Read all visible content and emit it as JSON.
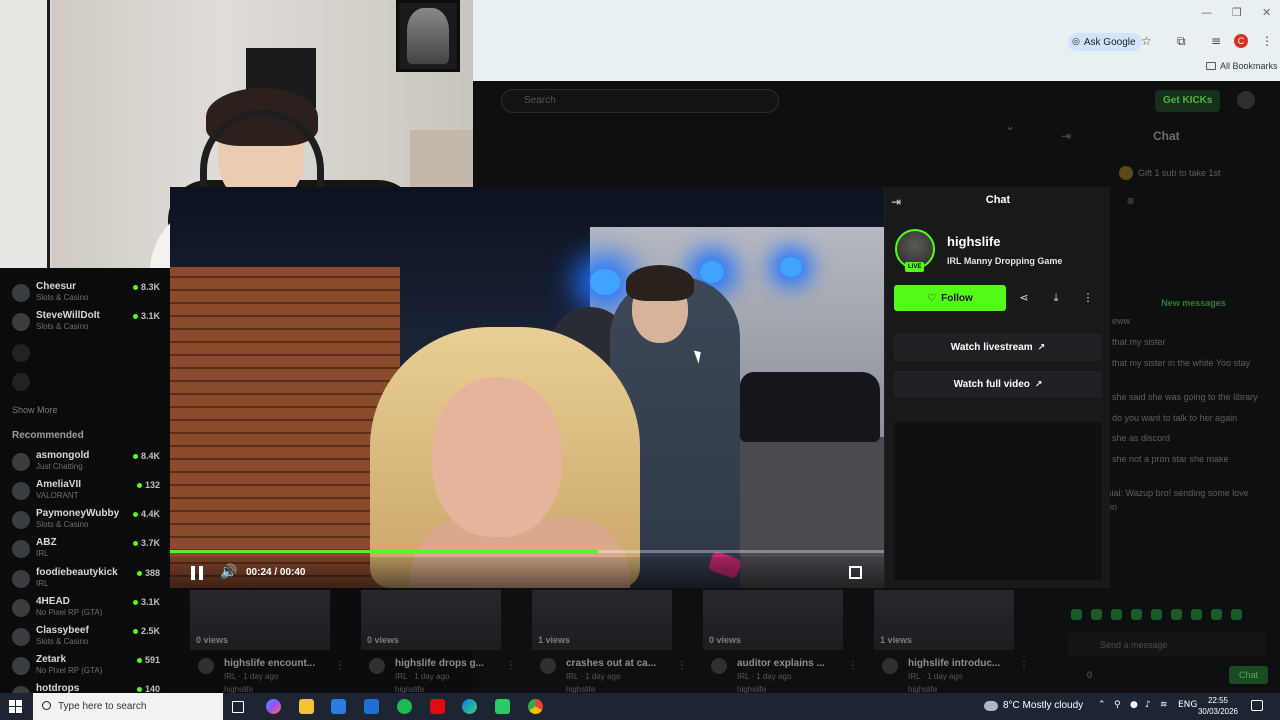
{
  "browser": {
    "ask_google": "Ask Google",
    "profile_initial": "C",
    "all_bookmarks": "All Bookmarks",
    "win_minimize": "—",
    "win_restore": "❐",
    "win_close": "✕"
  },
  "page": {
    "search_placeholder": "Search",
    "get_kicks": "Get KICKs",
    "chat_title_bg": "Chat",
    "chat_bg_messages": [
      "Gift 1 sub to take 1st",
      ": eww",
      ": that my sister",
      ": that my sister in the white Yoo stay",
      ": she said she was going to the library",
      ": do you want to talk to her again",
      ": she as discord",
      ": she not a pron star she make",
      "sial: Wazup bro! sending some love",
      "en"
    ],
    "new_messages": "New messages",
    "send_message_placeholder": "Send a message",
    "chat_button": "Chat",
    "points": "0"
  },
  "sidebar": {
    "following": [
      {
        "name": "Cheesur",
        "category": "Slots & Casino",
        "viewers": "8.3K"
      },
      {
        "name": "SteveWillDoIt",
        "category": "Slots & Casino",
        "viewers": "3.1K"
      }
    ],
    "show_more": "Show More",
    "recommended_label": "Recommended",
    "recommended": [
      {
        "name": "asmongold",
        "category": "Just Chatting",
        "viewers": "8.4K"
      },
      {
        "name": "AmeliaVII",
        "category": "VALORANT",
        "viewers": "132"
      },
      {
        "name": "PaymoneyWubby",
        "category": "Slots & Casino",
        "viewers": "4.4K"
      },
      {
        "name": "ABZ",
        "category": "IRL",
        "viewers": "3.7K"
      },
      {
        "name": "foodiebeautykick",
        "category": "IRL",
        "viewers": "388"
      },
      {
        "name": "4HEAD",
        "category": "No Pixel RP (GTA)",
        "viewers": "3.1K"
      },
      {
        "name": "Classybeef",
        "category": "Slots & Casino",
        "viewers": "2.5K"
      },
      {
        "name": "Zetark",
        "category": "No Pixel RP (GTA)",
        "viewers": "591"
      },
      {
        "name": "hotdrops",
        "category": "",
        "viewers": "140"
      }
    ]
  },
  "player": {
    "time": "00:24 / 00:40",
    "progress": 0.6
  },
  "chat_panel": {
    "title": "Chat",
    "channel_name": "highslife",
    "stream_title": "IRL Manny Dropping Game",
    "live": "LIVE",
    "follow": "Follow",
    "watch_livestream": "Watch livestream",
    "watch_full_video": "Watch full video"
  },
  "thumbnails": [
    {
      "views": "0 views",
      "title": "highslife encount...",
      "meta": "IRL · 1 day ago",
      "user": "highslife"
    },
    {
      "views": "0 views",
      "title": "highslife drops g...",
      "meta": "IRL · 1 day ago",
      "user": "highslife"
    },
    {
      "views": "1 views",
      "title": "crashes out at ca...",
      "meta": "IRL · 1 day ago",
      "user": "highslife"
    },
    {
      "views": "0 views",
      "title": "auditor explains ...",
      "meta": "IRL · 1 day ago",
      "user": "highslife"
    },
    {
      "views": "1 views",
      "title": "highslife introduc...",
      "meta": "IRL · 1 day ago",
      "user": "highslife"
    }
  ],
  "taskbar": {
    "search_placeholder": "Type here to search",
    "weather": "8°C  Mostly cloudy",
    "language": "ENG",
    "time": "22:55",
    "date": "30/03/2026"
  },
  "colors": {
    "kick_green": "#53fc18",
    "taskbar": "#1d2533"
  }
}
